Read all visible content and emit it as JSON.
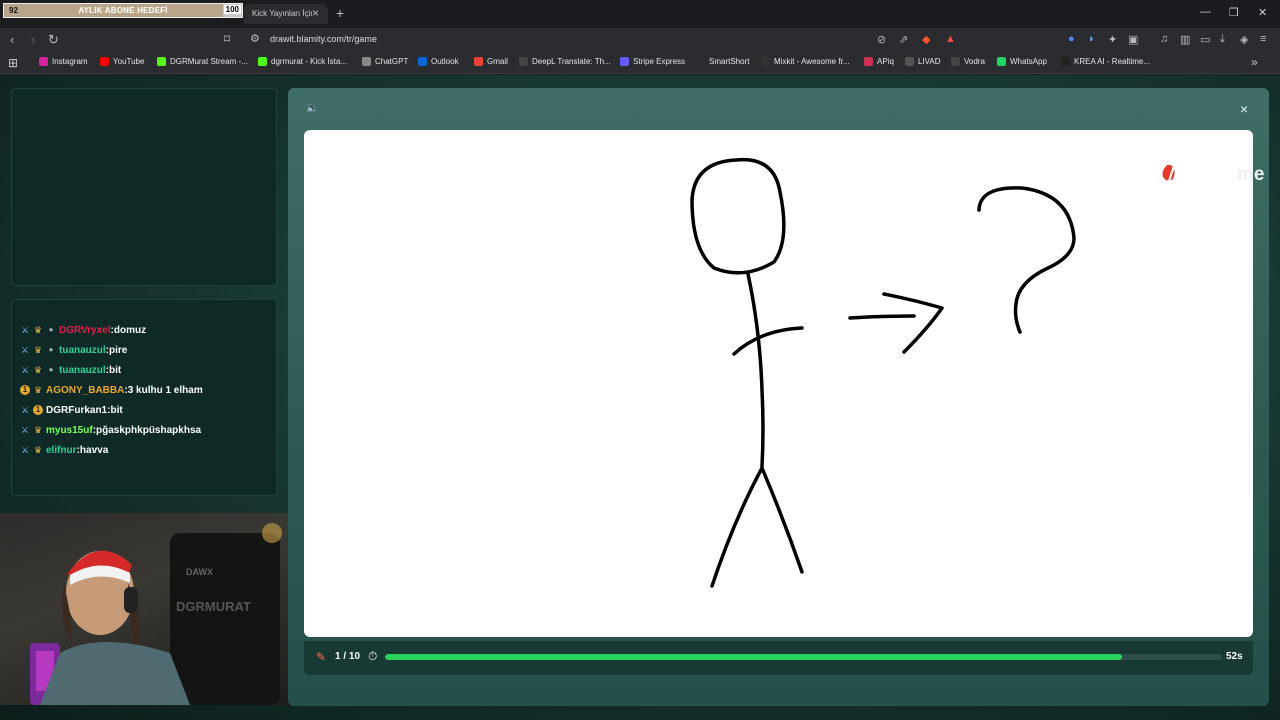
{
  "overlay": {
    "goal_current": "92",
    "goal_label": "AYLIK ABONE HEDEFİ",
    "goal_target": "100",
    "goal_progress": 0.92
  },
  "browser": {
    "tab_title": "Kick Yayınları İçin Ç",
    "url": "drawit.blamity.com/tr/game",
    "bookmarks": [
      {
        "label": "Instagram",
        "icon": "instagram-icon",
        "color": "#d6249f"
      },
      {
        "label": "YouTube",
        "icon": "youtube-icon",
        "color": "#ff0000"
      },
      {
        "label": "DGRMurat Stream -...",
        "icon": "kick-icon",
        "color": "#53fc18"
      },
      {
        "label": "dgrmurat - Kick İsta...",
        "icon": "kick-icon",
        "color": "#53fc18"
      },
      {
        "label": "ChatGPT",
        "icon": "chatgpt-icon",
        "color": "#888888"
      },
      {
        "label": "Outlook",
        "icon": "outlook-icon",
        "color": "#0a64d6"
      },
      {
        "label": "Gmail",
        "icon": "gmail-icon",
        "color": "#ea4335"
      },
      {
        "label": "DeepL Translate: Th...",
        "icon": "deepl-icon",
        "color": "#444444"
      },
      {
        "label": "Stripe Express",
        "icon": "stripe-icon",
        "color": "#635bff"
      },
      {
        "label": "SmartShort",
        "icon": "smartshort-icon",
        "color": "#2a2c30"
      },
      {
        "label": "Mixkit - Awesome fr...",
        "icon": "mixkit-icon",
        "color": "#333333"
      },
      {
        "label": "APiq",
        "icon": "apiq-icon",
        "color": "#cc3355"
      },
      {
        "label": "LIVAD",
        "icon": "livad-icon",
        "color": "#555555"
      },
      {
        "label": "Vodra",
        "icon": "vodra-icon",
        "color": "#444444"
      },
      {
        "label": "WhatsApp",
        "icon": "whatsapp-icon",
        "color": "#25d366"
      },
      {
        "label": "KREA AI - Realtime...",
        "icon": "krea-icon",
        "color": "#222222"
      }
    ]
  },
  "chat": {
    "messages": [
      {
        "user": "DGRVryxel",
        "text": "domuz",
        "user_color": "#e0204a",
        "badges": [
          "sword",
          "crown",
          "gift"
        ]
      },
      {
        "user": "tuanauzul",
        "text": "pire",
        "user_color": "#2ecf9a",
        "badges": [
          "sword",
          "crown",
          "gift"
        ]
      },
      {
        "user": "tuanauzul",
        "text": "bit",
        "user_color": "#2ecf9a",
        "badges": [
          "sword",
          "crown",
          "gift"
        ]
      },
      {
        "user": "AGONY_BABBA",
        "text": "3 kulhu 1 elham",
        "user_color": "#e8a830",
        "badges": [
          "one",
          "crown"
        ]
      },
      {
        "user": "DGRFurkan1",
        "text": "bit",
        "user_color": "#ffffff",
        "badges": [
          "sword",
          "one"
        ]
      },
      {
        "user": "myus15uf",
        "text": "pğaskphkpüshapkhsa",
        "user_color": "#7dff5a",
        "badges": [
          "sword",
          "crown"
        ]
      },
      {
        "user": "elifnur",
        "text": "havva",
        "user_color": "#2ecf9a",
        "badges": [
          "sword",
          "crown"
        ]
      }
    ]
  },
  "game": {
    "round": "1 / 10",
    "time_left": "52s",
    "time_progress": 0.88
  }
}
